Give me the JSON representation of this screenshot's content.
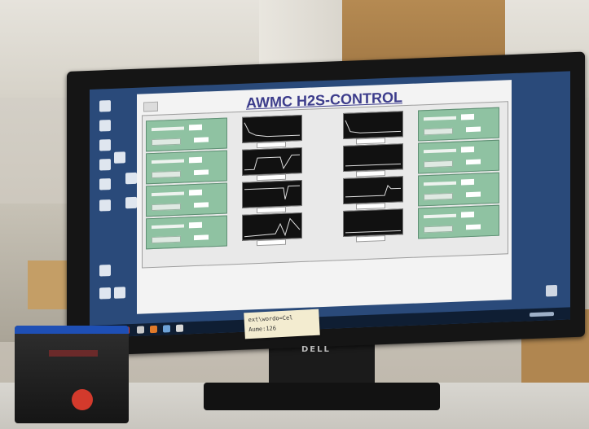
{
  "app": {
    "title": "AWMC H2S-CONTROL"
  },
  "sticky_note": {
    "line1": "ext\\wordo=Cel",
    "line2": "Aume:126"
  },
  "monitor": {
    "brand": "DELL"
  },
  "colors": {
    "panel_green": "#8fc2a2",
    "title_blue": "#3d3d8c",
    "screen_background": "#2a4a7a",
    "device_red_button": "#d33a2c"
  },
  "icons": [
    "desktop-icon",
    "start-button-icon",
    "taskbar-app-icon",
    "clock-icon"
  ]
}
